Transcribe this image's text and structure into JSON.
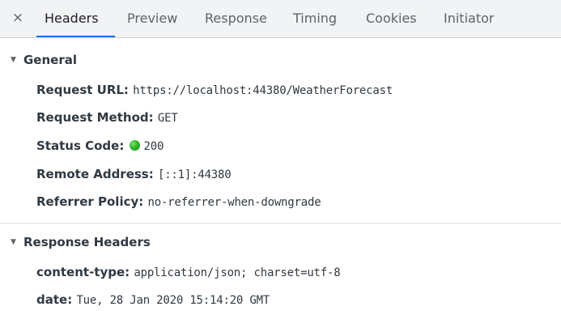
{
  "tabs": {
    "close_glyph": "×",
    "items": [
      "Headers",
      "Preview",
      "Response",
      "Timing",
      "Cookies",
      "Initiator"
    ],
    "active": "Headers"
  },
  "general": {
    "arrow": "▼",
    "title": "General",
    "rows": [
      {
        "key": "Request URL:",
        "value": "https://localhost:44380/WeatherForecast"
      },
      {
        "key": "Request Method:",
        "value": "GET"
      },
      {
        "key": "Status Code:",
        "value": "200",
        "status_color": "#2fb52a"
      },
      {
        "key": "Remote Address:",
        "value": "[::1]:44380"
      },
      {
        "key": "Referrer Policy:",
        "value": "no-referrer-when-downgrade"
      }
    ]
  },
  "response_headers": {
    "arrow": "▼",
    "title": "Response Headers",
    "rows": [
      {
        "key": "content-type:",
        "value": "application/json; charset=utf-8"
      },
      {
        "key": "date:",
        "value": "Tue, 28 Jan 2020 15:14:20 GMT"
      }
    ]
  },
  "colors": {
    "accent": "#1a73e8",
    "tabbar_bg": "#f1f3f4"
  }
}
